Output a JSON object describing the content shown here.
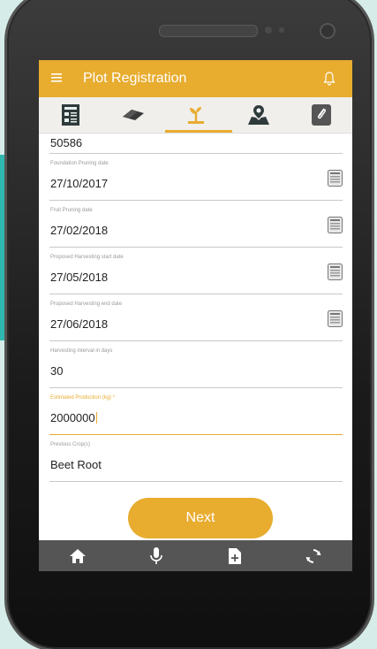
{
  "app": {
    "title": "Plot Registration"
  },
  "tabs": [
    {
      "icon": "document-list-icon"
    },
    {
      "icon": "land-plot-icon"
    },
    {
      "icon": "plant-sprout-icon"
    },
    {
      "icon": "map-location-icon"
    },
    {
      "icon": "attachment-icon"
    }
  ],
  "fields": {
    "top_value": "50586",
    "foundation_pruning": {
      "label": "Foundation Pruning date",
      "value": "27/10/2017"
    },
    "fruit_pruning": {
      "label": "Fruit Pruning date",
      "value": "27/02/2018"
    },
    "harvest_start": {
      "label": "Proposed Harvesting start date",
      "value": "27/05/2018"
    },
    "harvest_end": {
      "label": "Proposed Harvesting end date",
      "value": "27/06/2018"
    },
    "harvest_interval": {
      "label": "Harvesting interval in days",
      "value": "30"
    },
    "estimated_production": {
      "label": "Estimated Production (kg) *",
      "value": "2000000"
    },
    "previous_crop": {
      "label": "Previous Crop(s)",
      "value": "Beet Root"
    }
  },
  "buttons": {
    "next": "Next"
  },
  "bottom_bar": [
    "home-icon",
    "microphone-icon",
    "add-document-icon",
    "sync-icon"
  ],
  "colors": {
    "accent": "#e8ac2f",
    "bottom_bar": "#555555"
  }
}
